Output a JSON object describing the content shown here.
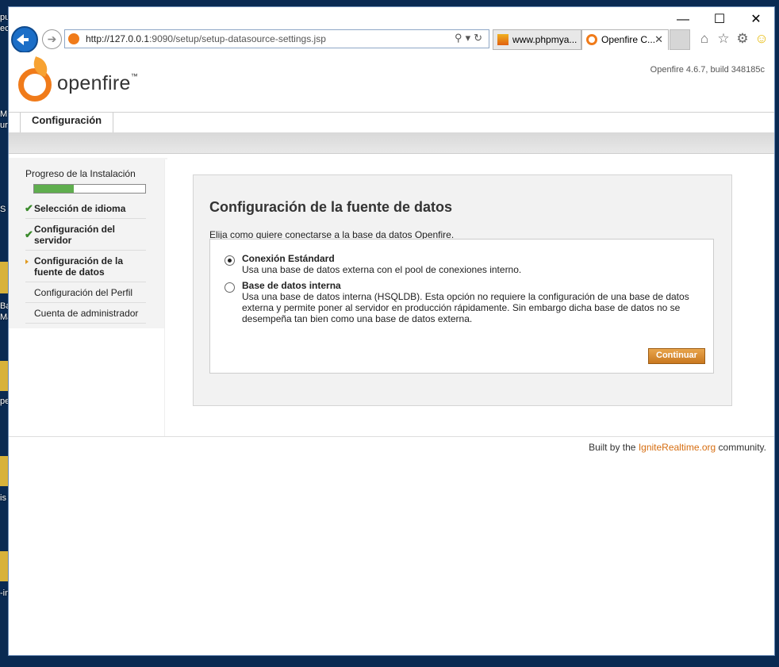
{
  "desktop": {
    "labels": [
      "pu",
      "ec",
      "M",
      "ur",
      "S",
      "Bac",
      "Ma",
      "pe",
      "is",
      "-in"
    ]
  },
  "browser": {
    "window_controls": {
      "minimize": "—",
      "maximize": "☐",
      "close": "✕"
    },
    "address_url_host": "http://127.0.0.1",
    "address_url_rest": ":9090/setup/setup-datasource-settings.jsp",
    "tabs": [
      {
        "label": "www.phpmya...",
        "favicon": "pma-icon"
      },
      {
        "label": "Openfire C...",
        "favicon": "openfire-icon",
        "close": "✕"
      }
    ]
  },
  "header": {
    "logo_text": "openfire",
    "logo_tm": "™",
    "version": "Openfire 4.6.7, build 348185c",
    "nav_tab": "Configuración"
  },
  "sidebar": {
    "title": "Progreso de la Instalación",
    "progress_fraction": 0.36,
    "steps": [
      {
        "label": "Selección de idioma",
        "state": "done"
      },
      {
        "label": "Configuración del servidor",
        "state": "done"
      },
      {
        "label": "Configuración de la fuente de datos",
        "state": "current"
      },
      {
        "label": "Configuración del Perfil",
        "state": "pending"
      },
      {
        "label": "Cuenta de administrador",
        "state": "pending"
      }
    ]
  },
  "main": {
    "title": "Configuración de la fuente de datos",
    "intro": "Elija como quiere conectarse a la base da datos Openfire.",
    "options": [
      {
        "label": "Conexión Estándard",
        "desc": "Usa una base de datos externa con el pool de conexiones interno.",
        "selected": true
      },
      {
        "label": "Base de datos interna",
        "desc": "Usa una base de datos interna (HSQLDB). Esta opción no requiere la configuración de una base de datos externa y permite poner al servidor en producción rápidamente. Sin embargo dicha base de datos no se desempeña tan bien como una base de datos externa.",
        "selected": false
      }
    ],
    "continue_label": "Continuar"
  },
  "footer": {
    "prefix": "Built by the ",
    "link": "IgniteRealtime.org",
    "suffix": " community."
  },
  "colors": {
    "accent": "#d66d10",
    "progress": "#5fae4e",
    "button": "#d98a2e"
  }
}
